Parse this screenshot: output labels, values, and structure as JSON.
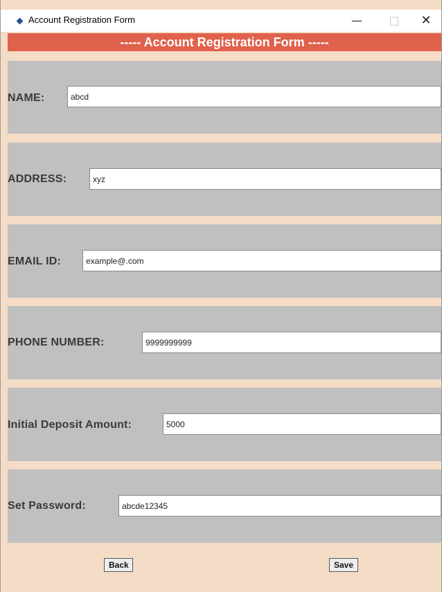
{
  "window": {
    "title": "Account Registration Form",
    "minimize_glyph": "—",
    "maximize_glyph": "□",
    "close_glyph": "✕"
  },
  "form": {
    "heading": "----- Account Registration Form -----",
    "fields": [
      {
        "label": "NAME:",
        "value": "abcd"
      },
      {
        "label": "ADDRESS:",
        "value": "xyz"
      },
      {
        "label": "EMAIL ID:",
        "value": "example@.com"
      },
      {
        "label": "PHONE NUMBER:",
        "value": "9999999999"
      },
      {
        "label": "Initial Deposit Amount:",
        "value": "5000"
      },
      {
        "label": "Set Password:",
        "value": "abcde12345"
      }
    ]
  },
  "buttons": {
    "back": "Back",
    "save": "Save"
  },
  "colors": {
    "background": "#f5dcc6",
    "heading": "#e0614c",
    "row": "#c0c0c0"
  }
}
